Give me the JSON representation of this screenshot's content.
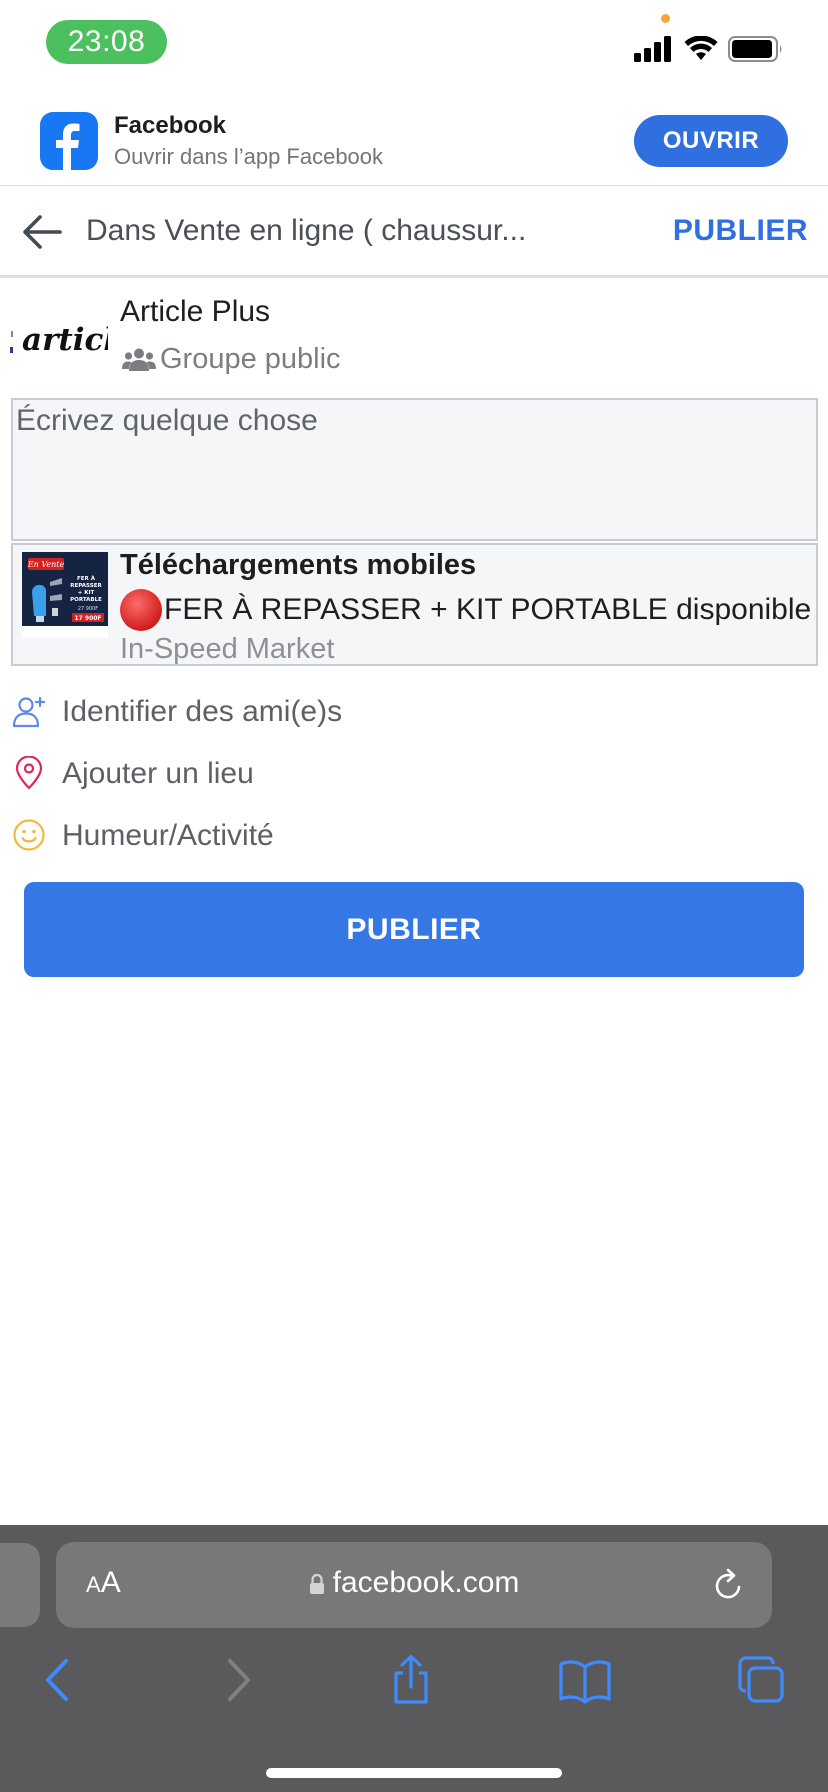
{
  "status_bar": {
    "time": "23:08"
  },
  "app_banner": {
    "title": "Facebook",
    "subtitle": "Ouvrir dans l’app Facebook",
    "open_label": "OUVRIR"
  },
  "header": {
    "title": "Dans Vente en ligne ( chaussur...",
    "publish_label": "PUBLIER"
  },
  "group": {
    "name": "Article Plus",
    "type": "Groupe public",
    "avatar_text": "article"
  },
  "composer": {
    "placeholder": "Écrivez quelque chose",
    "value": ""
  },
  "link_preview": {
    "title": "Téléchargements mobiles",
    "description": "FER À REPASSER + KIT PORTABLE disponible",
    "source": "In-Speed Market",
    "thumbnail": {
      "badge": "En Vente",
      "lines": [
        "FER À",
        "REPASSER",
        "+ KIT",
        "PORTABLE"
      ],
      "price_old": "27 900F",
      "price_new": "17 900F"
    }
  },
  "options": [
    {
      "label": "Identifier des ami(e)s",
      "icon": "add-person-icon"
    },
    {
      "label": "Ajouter un lieu",
      "icon": "location-pin-icon"
    },
    {
      "label": "Humeur/Activité",
      "icon": "smiley-icon"
    }
  ],
  "publish_button": {
    "label": "PUBLIER"
  },
  "browser": {
    "aa_small": "A",
    "aa_large": "A",
    "url": "facebook.com"
  },
  "colors": {
    "accent": "#3578e5",
    "status_pill": "#4cc05f",
    "toolbar": "#5a5a5c"
  }
}
